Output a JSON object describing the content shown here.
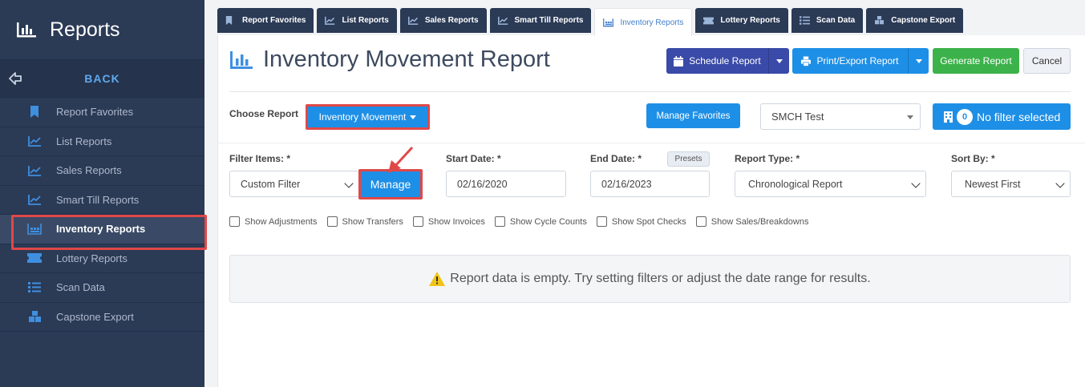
{
  "sidebar": {
    "title": "Reports",
    "back_label": "BACK",
    "items": [
      {
        "label": "Report Favorites"
      },
      {
        "label": "List Reports"
      },
      {
        "label": "Sales Reports"
      },
      {
        "label": "Smart Till Reports"
      },
      {
        "label": "Inventory Reports"
      },
      {
        "label": "Lottery Reports"
      },
      {
        "label": "Scan Data"
      },
      {
        "label": "Capstone Export"
      }
    ]
  },
  "tabs": [
    {
      "label": "Report Favorites"
    },
    {
      "label": "List Reports"
    },
    {
      "label": "Sales Reports"
    },
    {
      "label": "Smart Till Reports"
    },
    {
      "label": "Inventory Reports"
    },
    {
      "label": "Lottery Reports"
    },
    {
      "label": "Scan Data"
    },
    {
      "label": "Capstone Export"
    }
  ],
  "header": {
    "title": "Inventory Movement Report",
    "schedule_label": "Schedule Report",
    "print_label": "Print/Export Report",
    "generate_label": "Generate Report",
    "cancel_label": "Cancel"
  },
  "choose": {
    "label": "Choose Report",
    "selected": "Inventory Movement",
    "manage_favorites": "Manage Favorites",
    "store": "SMCH Test",
    "filter_count": "0",
    "filter_text": "No filter selected"
  },
  "filters": {
    "filter_items_label": "Filter Items: *",
    "filter_items_value": "Custom Filter",
    "manage_label": "Manage",
    "start_label": "Start Date: *",
    "start_value": "02/16/2020",
    "end_label": "End Date: *",
    "end_value": "02/16/2023",
    "presets_label": "Presets",
    "report_type_label": "Report Type: *",
    "report_type_value": "Chronological Report",
    "sort_label": "Sort By: *",
    "sort_value": "Newest First"
  },
  "checkboxes": [
    {
      "label": "Show Adjustments"
    },
    {
      "label": "Show Transfers"
    },
    {
      "label": "Show Invoices"
    },
    {
      "label": "Show Cycle Counts"
    },
    {
      "label": "Show Spot Checks"
    },
    {
      "label": "Show Sales/Breakdowns"
    }
  ],
  "empty_message": "Report data is empty. Try setting filters or adjust the date range for results.",
  "colors": {
    "sidebar_bg": "#2b3a55",
    "primary": "#1e8fe6",
    "schedule": "#3a4aa8",
    "generate": "#3cb24a",
    "highlight": "#e04848"
  }
}
